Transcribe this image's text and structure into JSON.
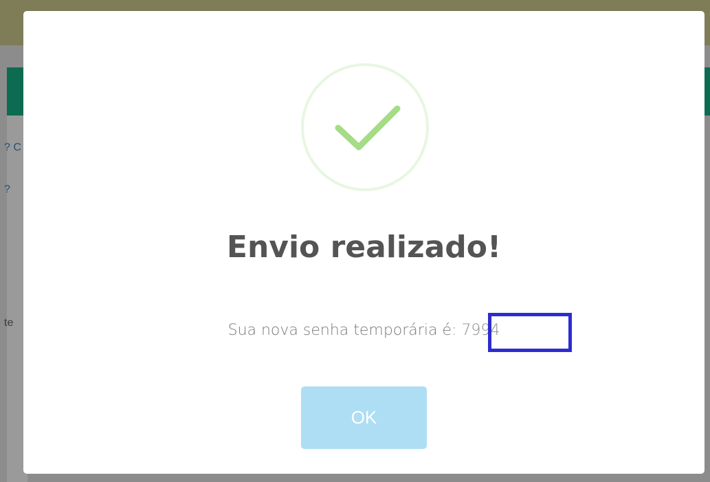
{
  "background": {
    "left_text_1": "? C",
    "left_text_2": "?",
    "left_text_3": "te"
  },
  "modal": {
    "icon": "success-check-icon",
    "title": "Envio realizado!",
    "message_prefix": "Sua nova senha temporária é:",
    "password": "7994",
    "ok_label": "OK"
  },
  "colors": {
    "check": "#a5dc86",
    "ok_button": "#aedef4",
    "highlight": "#2d2ccf"
  }
}
